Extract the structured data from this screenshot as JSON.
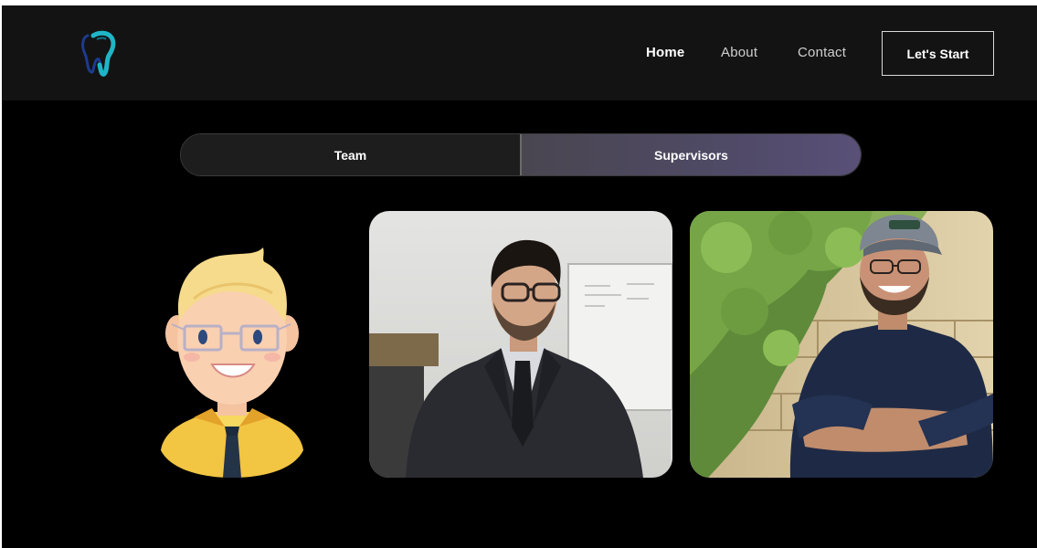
{
  "nav": {
    "links": [
      "Home",
      "About",
      "Contact"
    ],
    "cta": "Let's Start"
  },
  "toggle": {
    "team": "Team",
    "supervisors": "Supervisors"
  },
  "colors": {
    "background": "#000000",
    "navbar": "#131313",
    "logo_accent": "#1fb5c8",
    "toggle_active": "#4f4a66"
  },
  "cards": [
    {
      "type": "cartoon-avatar"
    },
    {
      "type": "photo-suit"
    },
    {
      "type": "photo-cap"
    }
  ]
}
